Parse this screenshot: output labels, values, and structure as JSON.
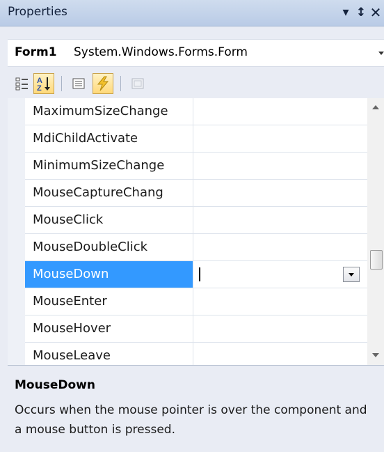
{
  "panel": {
    "title": "Properties"
  },
  "selector": {
    "name": "Form1",
    "type": "System.Windows.Forms.Form"
  },
  "grid": {
    "rows": [
      {
        "name": "MaximumSizeChange",
        "value": ""
      },
      {
        "name": "MdiChildActivate",
        "value": ""
      },
      {
        "name": "MinimumSizeChange",
        "value": ""
      },
      {
        "name": "MouseCaptureChang",
        "value": ""
      },
      {
        "name": "MouseClick",
        "value": ""
      },
      {
        "name": "MouseDoubleClick",
        "value": ""
      },
      {
        "name": "MouseDown",
        "value": "",
        "selected": true
      },
      {
        "name": "MouseEnter",
        "value": ""
      },
      {
        "name": "MouseHover",
        "value": ""
      },
      {
        "name": "MouseLeave",
        "value": ""
      }
    ]
  },
  "description": {
    "title": "MouseDown",
    "text": "Occurs when the mouse pointer is over the component and a mouse button is pressed."
  },
  "colors": {
    "selection": "#3399ff",
    "titlebar": "#c3d3ea"
  },
  "icons": {
    "toolbar": [
      "categorized-icon",
      "alphabetical-icon",
      "properties-icon",
      "events-icon",
      "property-pages-icon"
    ]
  }
}
